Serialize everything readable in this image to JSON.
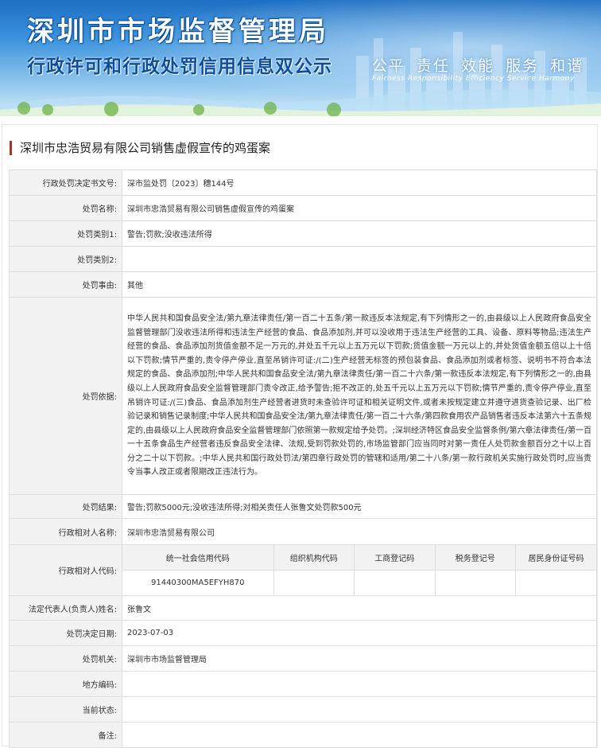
{
  "banner": {
    "title": "深圳市市场监督管理局",
    "subtitle": "行政许可和行政处罚信用信息双公示",
    "motto_cn": "公平 责任 效能 服务 和谐",
    "motto_en": "Fairness Responsibility Efficiency Service Harmony"
  },
  "case": {
    "title": "深圳市忠浩贸易有限公司销售虚假宣传的鸡蛋案",
    "labels": {
      "doc_no": "行政处罚决定书文号:",
      "name": "处罚名称:",
      "category1": "处罚类别1:",
      "category2": "处罚类别2:",
      "reason": "处罚事由:",
      "basis": "处罚依据:",
      "result": "处罚结果:",
      "party_name": "行政相对人名称:",
      "party_codes": "行政相对人代码:",
      "legal_rep": "法定代表人(负责人)姓名:",
      "decision_date": "处罚决定日期:",
      "authority": "处罚机关:",
      "region_code": "地方编码:",
      "status": "当前状态:",
      "remarks": "备注:"
    },
    "values": {
      "doc_no": "深市监处罚〔2023〕穗144号",
      "name": "深圳市忠浩贸易有限公司销售虚假宣传的鸡蛋案",
      "category1": "警告;罚款;没收违法所得",
      "category2": "",
      "reason": "其他",
      "basis": "中华人民共和国食品安全法/第九章法律责任/第一百二十五条/第一款违反本法规定,有下列情形之一的,由县级以上人民政府食品安全监督管理部门没收违法所得和违法生产经营的食品、食品添加剂,并可以没收用于违法生产经营的工具、设备、原料等物品;违法生产经营的食品、食品添加剂货值金额不足一万元的,并处五千元以上五万元以下罚款;货值金额一万元以上的,并处货值金额五倍以上十倍以下罚款;情节严重的,责令停产停业,直至吊销许可证:/(二)生产经营无标签的预包装食品、食品添加剂或者标签、说明书不符合本法规定的食品、食品添加剂;中华人民共和国食品安全法/第九章法律责任/第一百二十六条/第一款违反本法规定,有下列情形之一的,由县级以上人民政府食品安全监督管理部门责令改正,给予警告;拒不改正的,处五千元以上五万元以下罚款;情节严重的,责令停产停业,直至吊销许可证:/(三)食品、食品添加剂生产经营者进货时未查验许可证和相关证明文件,或者未按规定建立并遵守进货查验记录、出厂检验记录和销售记录制度;中华人民共和国食品安全法/第九章法律责任/第一百二十六条/第四款食用农产品销售者违反本法第六十五条规定的,由县级以上人民政府食品安全监督管理部门依照第一款规定给予处罚。;深圳经济特区食品安全监督条例/第六章法律责任/第一百一十五条食品生产经营者违反食品安全法律、法规,受到罚款处罚的,市场监管部门应当同时对第一责任人处罚款金额百分之十以上百分之二十以下罚款。;中华人民共和国行政处罚法/第四章行政处罚的管辖和适用/第二十八条/第一款行政机关实施行政处罚时,应当责令当事人改正或者限期改正违法行为。",
      "result": "警告;罚款5000元;没收违法所得;对相关责任人张鲁文处罚款500元",
      "party_name": "深圳市忠浩贸易有限公司",
      "legal_rep": "张鲁文",
      "decision_date": "2023-07-03",
      "authority": "深圳市市场监督管理局",
      "region_code": "",
      "status": "",
      "remarks": ""
    },
    "codes": {
      "headers": [
        "统一社会信用代码",
        "组织机构代码",
        "工商登记码",
        "税务登记号",
        "居民身份证号码"
      ],
      "values": [
        "91440300MA5EFYH870",
        "",
        "",
        "",
        ""
      ]
    }
  }
}
